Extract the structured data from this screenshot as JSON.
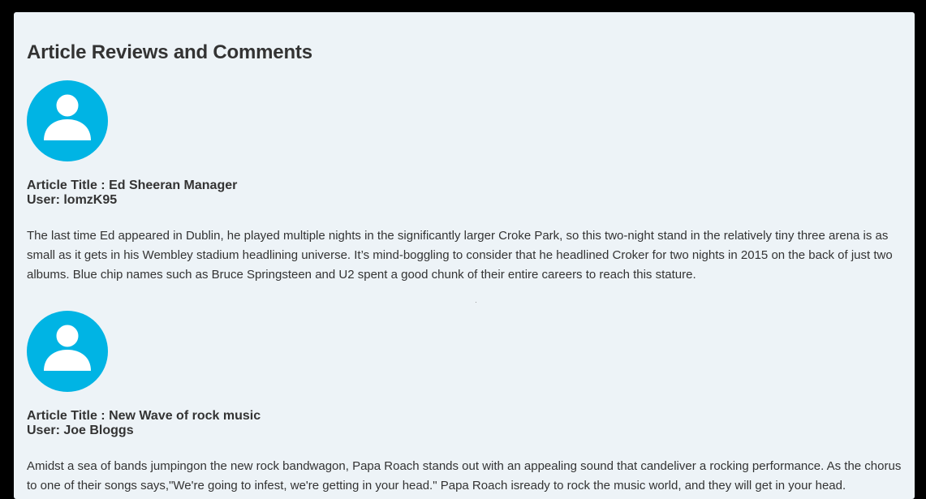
{
  "page": {
    "heading": "Article Reviews and Comments"
  },
  "reviews": [
    {
      "title_line": "Article Title : Ed Sheeran Manager",
      "user_line": "User: lomzK95",
      "text": "The last time Ed appeared in Dublin, he played multiple nights in the significantly larger Croke Park, so this two-night stand in the relatively tiny three arena is as small as it gets in his Wembley stadium headlining universe. It’s mind-boggling to consider that he headlined Croker for two nights in 2015 on the back of just two albums. Blue chip names such as Bruce Springsteen and U2 spent a good chunk of their entire careers to reach this stature."
    },
    {
      "title_line": "Article Title : New Wave of rock music",
      "user_line": "User: Joe Bloggs",
      "text": "Amidst a sea of bands jumpingon the new rock bandwagon, Papa Roach stands out with an appealing sound that candeliver a rocking performance. As the chorus to one of their songs says,\"We're going to infest, we're getting in your head.\" Papa Roach isready to rock the music world, and they will get in your head."
    }
  ],
  "colors": {
    "avatar_bg": "#00b4e4",
    "avatar_fg": "#ffffff",
    "panel_bg": "#edf3f7",
    "text": "#333333"
  },
  "icons": {
    "avatar": "user-avatar-icon"
  }
}
